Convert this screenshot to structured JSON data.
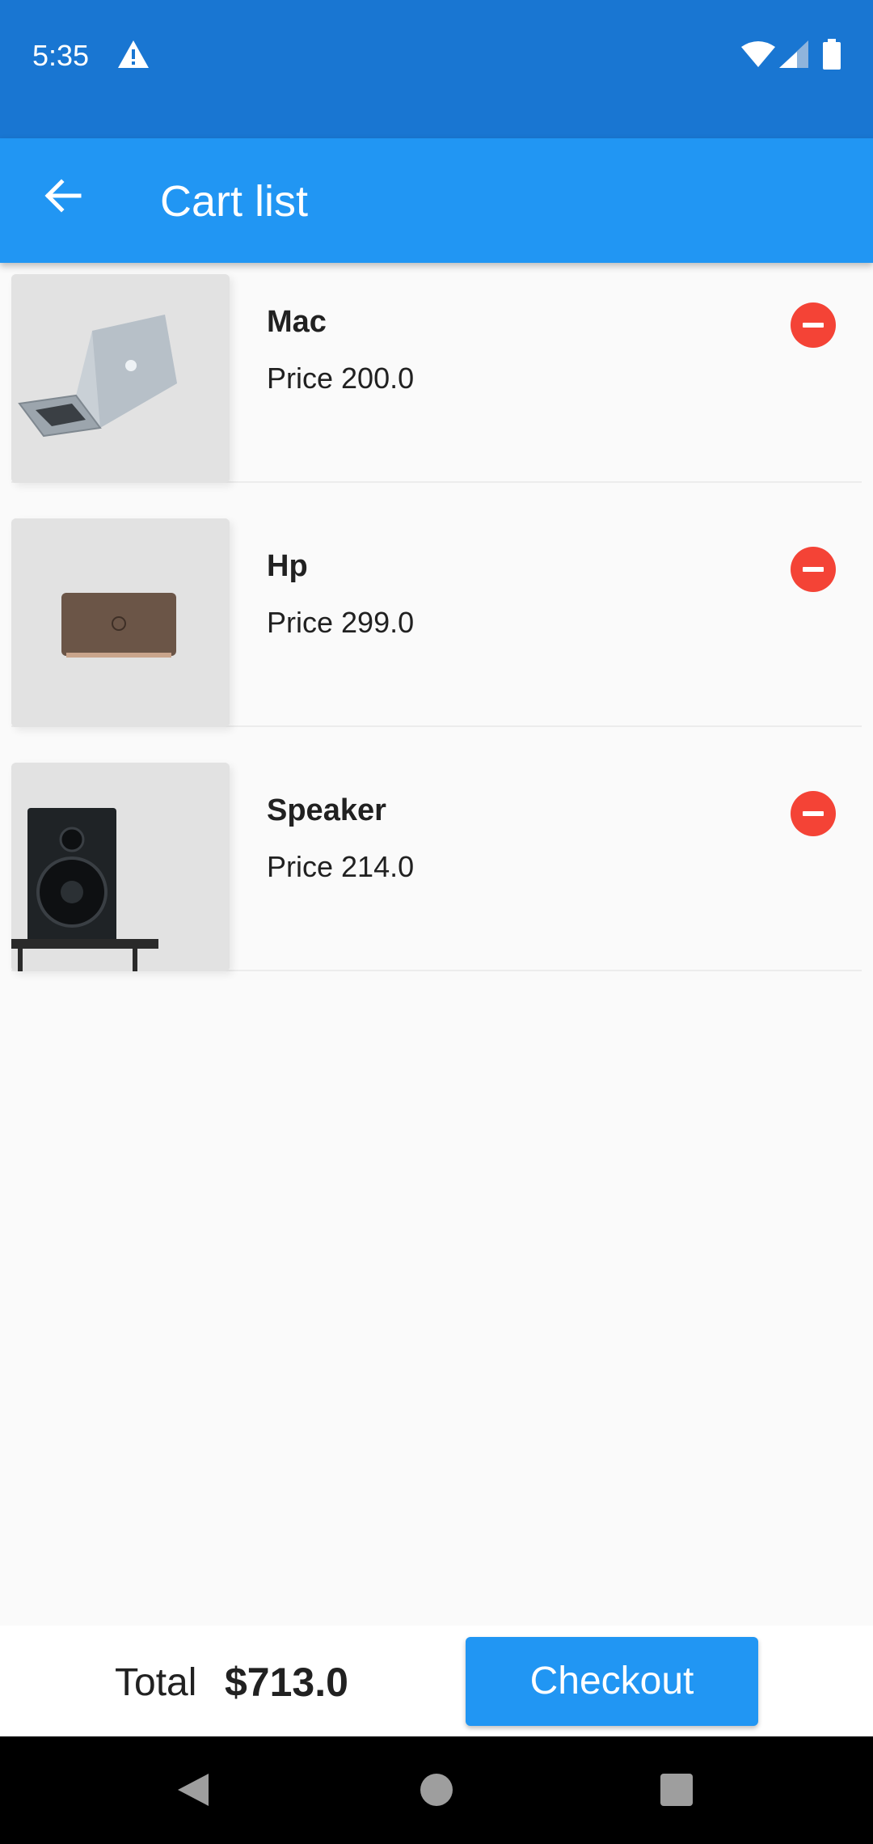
{
  "status_bar": {
    "time": "5:35",
    "icons": [
      "warning-icon",
      "wifi-icon",
      "signal-icon",
      "battery-icon"
    ]
  },
  "app_bar": {
    "back_icon": "arrow-left-icon",
    "title": "Cart list",
    "color": "#2196f3"
  },
  "cart": {
    "items": [
      {
        "name": "Mac",
        "price": "Price 200.0",
        "image": "laptop-silver-image"
      },
      {
        "name": "Hp",
        "price": "Price 299.0",
        "image": "laptop-brown-image"
      },
      {
        "name": "Speaker",
        "price": "Price 214.0",
        "image": "speaker-image"
      }
    ],
    "remove_icon": "minus-circle-icon",
    "remove_color": "#f44336"
  },
  "footer": {
    "total_label": "Total",
    "total_value": "$713.0",
    "checkout_label": "Checkout"
  },
  "nav_bar": {
    "icons": [
      "back-triangle-icon",
      "home-circle-icon",
      "recents-square-icon"
    ]
  }
}
